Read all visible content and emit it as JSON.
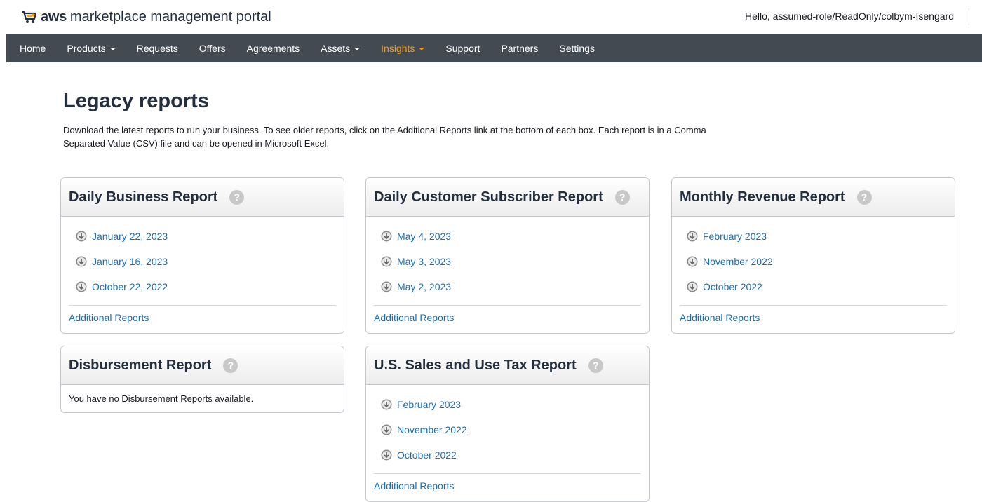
{
  "header": {
    "logo_aws": "aws",
    "logo_rest": "marketplace management portal",
    "greeting": "Hello, assumed-role/ReadOnly/colbym-Isengard"
  },
  "nav": {
    "home": "Home",
    "products": "Products",
    "requests": "Requests",
    "offers": "Offers",
    "agreements": "Agreements",
    "assets": "Assets",
    "insights": "Insights",
    "support": "Support",
    "partners": "Partners",
    "settings": "Settings"
  },
  "page": {
    "title": "Legacy reports",
    "description": "Download the latest reports to run your business. To see older reports, click on the Additional Reports link at the bottom of each box. Each report is in a Comma Separated Value (CSV) file and can be opened in Microsoft Excel."
  },
  "reports": {
    "daily_business": {
      "title": "Daily Business Report",
      "links": [
        "January 22, 2023",
        "January 16, 2023",
        "October 22, 2022"
      ],
      "additional": "Additional Reports"
    },
    "daily_customer": {
      "title": "Daily Customer Subscriber Report",
      "links": [
        "May 4, 2023",
        "May 3, 2023",
        "May 2, 2023"
      ],
      "additional": "Additional Reports"
    },
    "monthly_revenue": {
      "title": "Monthly Revenue Report",
      "links": [
        "February 2023",
        "November 2022",
        "October 2022"
      ],
      "additional": "Additional Reports"
    },
    "disbursement": {
      "title": "Disbursement Report",
      "empty_message": "You have no Disbursement Reports available."
    },
    "us_sales_tax": {
      "title": "U.S. Sales and Use Tax Report",
      "links": [
        "February 2023",
        "November 2022",
        "October 2022"
      ],
      "additional": "Additional Reports"
    }
  },
  "icons": {
    "help": "?",
    "help_color": "#c8c8c8",
    "download_color": "#888888"
  },
  "colors": {
    "nav_bg": "#444a52",
    "nav_active": "#ec9a1c",
    "link": "#1a6fb5"
  }
}
